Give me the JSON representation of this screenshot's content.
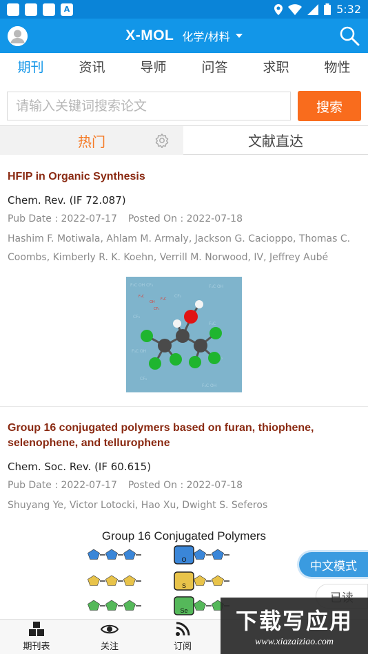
{
  "status_bar": {
    "time": "5:32",
    "notif_letter": "A"
  },
  "app_bar": {
    "title": "X-MOL",
    "subject": "化学/材料"
  },
  "nav_tabs": [
    "期刊",
    "资讯",
    "导师",
    "问答",
    "求职",
    "物性"
  ],
  "search": {
    "placeholder": "请输入关键词搜索论文",
    "button": "搜索"
  },
  "sub_tabs": {
    "hot": "热门",
    "direct": "文献直达"
  },
  "articles": [
    {
      "title": "HFIP in Organic Synthesis",
      "journal": "Chem. Rev. (IF 72.087)",
      "pub_date": "Pub Date : 2022-07-17",
      "posted_on": "Posted On : 2022-07-18",
      "authors": "Hashim F. Motiwala, Ahlam M. Armaly, Jackson G. Cacioppo, Thomas C. Coombs, Kimberly R. K. Koehn, Verrill M. Norwood, IV, Jeffrey Aubé"
    },
    {
      "title": "Group 16 conjugated polymers based on furan, thiophene, selenophene, and tellurophene",
      "journal": "Chem. Soc. Rev. (IF 60.615)",
      "pub_date": "Pub Date : 2022-07-17",
      "posted_on": "Posted On : 2022-07-18",
      "authors": "Shuyang Ye, Victor Lotocki, Hao Xu, Dwight S. Seferos",
      "image_caption": "Group 16 Conjugated Polymers",
      "ring_labels": [
        "O",
        "S",
        "Se"
      ]
    }
  ],
  "floating": {
    "chinese_mode": "中文模式",
    "read": "已读"
  },
  "bottom_nav": [
    "期刊表",
    "关注",
    "订阅"
  ],
  "watermark": {
    "line1": "下载写应用",
    "line2": "www.xiazaiziao.com"
  },
  "colors": {
    "primary": "#1296e8",
    "accent": "#f96c1d",
    "title": "#8a2a12"
  }
}
